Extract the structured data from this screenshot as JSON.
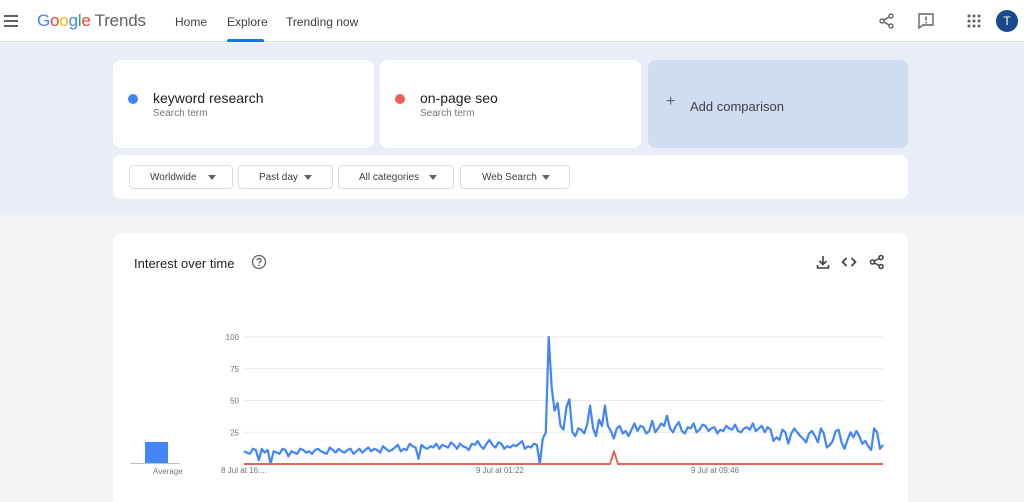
{
  "header": {
    "logo_google": [
      "G",
      "o",
      "o",
      "g",
      "l",
      "e"
    ],
    "logo_trends": "Trends",
    "nav": [
      {
        "label": "Home"
      },
      {
        "label": "Explore"
      },
      {
        "label": "Trending now"
      }
    ],
    "avatar_initial": "T"
  },
  "terms": [
    {
      "name": "keyword research",
      "sub": "Search term",
      "color": "#4285f4"
    },
    {
      "name": "on-page seo",
      "sub": "Search term",
      "color": "#e8615a"
    }
  ],
  "add_comparison": {
    "plus": "+",
    "label": "Add comparison"
  },
  "filters": [
    {
      "label": "Worldwide"
    },
    {
      "label": "Past day"
    },
    {
      "label": "All categories"
    },
    {
      "label": "Web Search"
    }
  ],
  "chart_card": {
    "title": "Interest over time",
    "help_icon": "help-circle-icon",
    "icons": [
      "download-icon",
      "embed-code-icon",
      "share-icon"
    ],
    "average_label": "Average"
  },
  "chart_data": {
    "type": "line",
    "ylim": [
      0,
      100
    ],
    "yticks": [
      25,
      50,
      75,
      100
    ],
    "xtick_labels": [
      "8 Jul at 16:...",
      "9 Jul at 01:22",
      "9 Jul at 09:46"
    ],
    "averages": [
      {
        "series": "keyword research",
        "value": 17
      },
      {
        "series": "on-page seo",
        "value": 0
      }
    ],
    "series": [
      {
        "name": "keyword research",
        "color": "#4285f4",
        "values": [
          10,
          9,
          8,
          12,
          11,
          3,
          12,
          9,
          11,
          0,
          10,
          9,
          8,
          12,
          11,
          6,
          10,
          9,
          8,
          12,
          11,
          9,
          10,
          8,
          11,
          12,
          10,
          9,
          8,
          13,
          11,
          9,
          12,
          10,
          9,
          11,
          12,
          8,
          10,
          12,
          9,
          11,
          13,
          10,
          12,
          11,
          9,
          14,
          12,
          10,
          11,
          13,
          15,
          10,
          12,
          11,
          16,
          14,
          13,
          4,
          15,
          13,
          12,
          14,
          13,
          16,
          12,
          15,
          14,
          13,
          17,
          15,
          12,
          16,
          14,
          13,
          11,
          16,
          15,
          18,
          14,
          12,
          16,
          19,
          15,
          13,
          17,
          16,
          12,
          14,
          13,
          15,
          14,
          16,
          18,
          12,
          14,
          13,
          16,
          15,
          0,
          20,
          25,
          100,
          60,
          42,
          48,
          30,
          27,
          45,
          51,
          25,
          22,
          28,
          27,
          24,
          31,
          46,
          28,
          22,
          35,
          30,
          46,
          30,
          26,
          20,
          28,
          30,
          24,
          26,
          22,
          27,
          32,
          26,
          30,
          29,
          24,
          26,
          34,
          25,
          28,
          32,
          30,
          38,
          28,
          25,
          30,
          33,
          26,
          24,
          29,
          28,
          32,
          25,
          27,
          31,
          30,
          26,
          28,
          29,
          24,
          27,
          26,
          30,
          28,
          27,
          31,
          26,
          25,
          28,
          29,
          27,
          32,
          26,
          28,
          30,
          25,
          29,
          27,
          18,
          21,
          19,
          27,
          25,
          16,
          24,
          28,
          25,
          22,
          20,
          17,
          24,
          26,
          22,
          17,
          28,
          24,
          13,
          15,
          18,
          26,
          27,
          17,
          12,
          19,
          25,
          21,
          26,
          22,
          16,
          18,
          14,
          11,
          28,
          25,
          12,
          15
        ]
      },
      {
        "name": "on-page seo",
        "color": "#e8615a",
        "spike": {
          "value": 10
        },
        "values": [
          0
        ]
      }
    ]
  }
}
